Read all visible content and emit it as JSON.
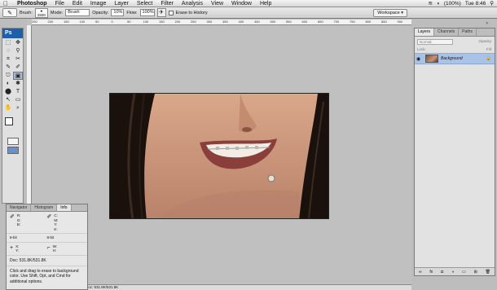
{
  "menubar": {
    "items": [
      "Photoshop",
      "File",
      "Edit",
      "Image",
      "Layer",
      "Select",
      "Filter",
      "Analysis",
      "View",
      "Window",
      "Help"
    ],
    "status": {
      "battery": "(100%)",
      "clock": "Tue 8:46"
    }
  },
  "options": {
    "brush_label": "Brush:",
    "brush_size": "2500",
    "mode_label": "Mode:",
    "mode_value": "Brush",
    "opacity_label": "Opacity:",
    "opacity_value": "10%",
    "flow_label": "Flow:",
    "flow_value": "100%",
    "erase_history": "Erase to History",
    "workspace": "Workspace ▾"
  },
  "toolbox": {
    "logo": "Ps",
    "tools": [
      "⬚",
      "✥",
      "◌",
      "⚲",
      "⌗",
      "✂",
      "✎",
      "✐",
      "⎋",
      "▣",
      "◐",
      "✱",
      "⬤",
      "T",
      "↖",
      "▭",
      "✋",
      "⌕"
    ]
  },
  "ruler": {
    "ticks": [
      "250",
      "200",
      "150",
      "100",
      "50",
      "0",
      "50",
      "100",
      "150",
      "200",
      "250",
      "300",
      "350",
      "400",
      "450",
      "500",
      "550",
      "600",
      "650",
      "700",
      "750",
      "800",
      "850",
      "900"
    ]
  },
  "document": {
    "status_text": "Doc: 531.8K/531.8K"
  },
  "info_panel": {
    "tabs": [
      "Navigator",
      "Histogram",
      "Info"
    ],
    "rgb_labels": "R:\nG:\nB:",
    "cmyk_labels": "C:\nM:\nY:\nK:",
    "bit1": "8-bit",
    "bit2": "8-bit",
    "xy_labels": "X:\nY:",
    "wh_labels": "W:\nH:",
    "doc": "Doc: 531.8K/531.8K",
    "hint": "Click and drag to erase to background color. Use Shift, Opt, and Cmd for additional options."
  },
  "layers_panel": {
    "tabs": [
      "Layers",
      "Channels",
      "Paths"
    ],
    "blend_mode": "Normal",
    "opacity_label": "Opacity:",
    "lock_label": "Lock:",
    "fill_label": "Fill:",
    "layer_name": "Background",
    "footer": [
      "∞",
      "fx",
      "◘",
      "◑",
      "▭",
      "⊞",
      "🗑"
    ]
  }
}
